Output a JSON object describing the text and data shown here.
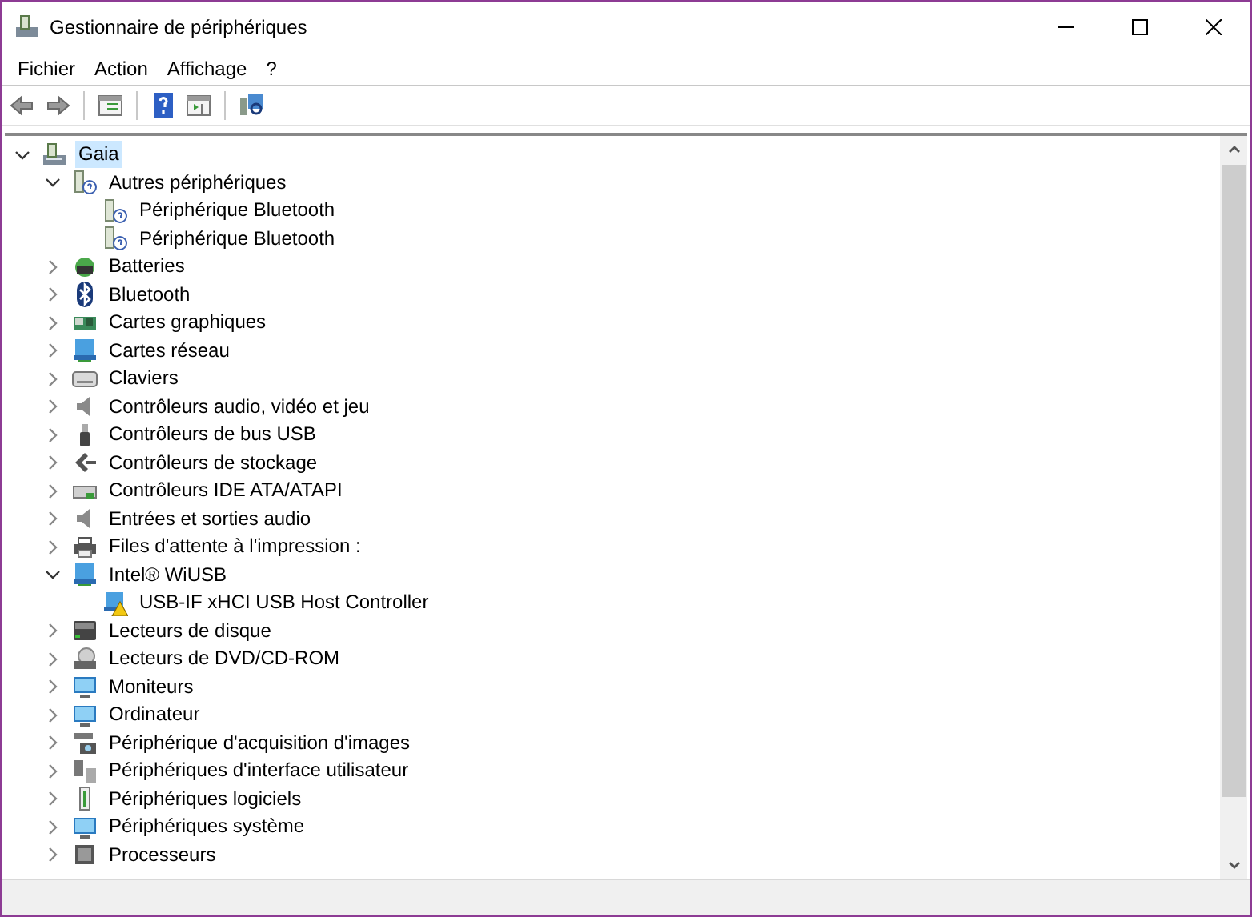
{
  "window": {
    "title": "Gestionnaire de périphériques"
  },
  "menu": [
    "Fichier",
    "Action",
    "Affichage",
    "?"
  ],
  "tree": {
    "items": [
      {
        "label": "Gaia",
        "kind": "computer",
        "expanded": true,
        "selected": true,
        "children": [
          {
            "label": "Autres périphériques",
            "kind": "unknown",
            "expanded": true,
            "selected": false,
            "children": [
              {
                "label": "Périphérique Bluetooth",
                "kind": "unknown",
                "selected": false
              },
              {
                "label": "Périphérique Bluetooth",
                "kind": "unknown",
                "selected": false
              }
            ]
          },
          {
            "label": "Batteries",
            "kind": "battery",
            "expanded": false,
            "selected": false
          },
          {
            "label": "Bluetooth",
            "kind": "bluetooth",
            "expanded": false,
            "selected": false
          },
          {
            "label": "Cartes graphiques",
            "kind": "graphics",
            "expanded": false,
            "selected": false
          },
          {
            "label": "Cartes réseau",
            "kind": "network",
            "expanded": false,
            "selected": false
          },
          {
            "label": "Claviers",
            "kind": "keyboard",
            "expanded": false,
            "selected": false
          },
          {
            "label": "Contrôleurs audio, vidéo et jeu",
            "kind": "speaker",
            "expanded": false,
            "selected": false
          },
          {
            "label": "Contrôleurs de bus USB",
            "kind": "usb",
            "expanded": false,
            "selected": false
          },
          {
            "label": "Contrôleurs de stockage",
            "kind": "storage",
            "expanded": false,
            "selected": false
          },
          {
            "label": "Contrôleurs IDE ATA/ATAPI",
            "kind": "ide",
            "expanded": false,
            "selected": false
          },
          {
            "label": "Entrées et sorties audio",
            "kind": "speaker",
            "expanded": false,
            "selected": false
          },
          {
            "label": "Files d'attente à l'impression :",
            "kind": "printer",
            "expanded": false,
            "selected": false
          },
          {
            "label": "Intel® WiUSB",
            "kind": "network",
            "expanded": true,
            "selected": false,
            "children": [
              {
                "label": "USB-IF xHCI USB Host Controller",
                "kind": "warning",
                "selected": false
              }
            ]
          },
          {
            "label": "Lecteurs de disque",
            "kind": "disk",
            "expanded": false,
            "selected": false
          },
          {
            "label": "Lecteurs de DVD/CD-ROM",
            "kind": "dvd",
            "expanded": false,
            "selected": false
          },
          {
            "label": "Moniteurs",
            "kind": "monitor",
            "expanded": false,
            "selected": false
          },
          {
            "label": "Ordinateur",
            "kind": "monitor",
            "expanded": false,
            "selected": false
          },
          {
            "label": "Périphérique d'acquisition d'images",
            "kind": "camera",
            "expanded": false,
            "selected": false
          },
          {
            "label": "Périphériques d'interface utilisateur",
            "kind": "hid",
            "expanded": false,
            "selected": false
          },
          {
            "label": "Périphériques logiciels",
            "kind": "software",
            "expanded": false,
            "selected": false
          },
          {
            "label": "Périphériques système",
            "kind": "monitor",
            "expanded": false,
            "selected": false
          },
          {
            "label": "Processeurs",
            "kind": "processor",
            "expanded": false,
            "selected": false
          }
        ]
      }
    ]
  }
}
